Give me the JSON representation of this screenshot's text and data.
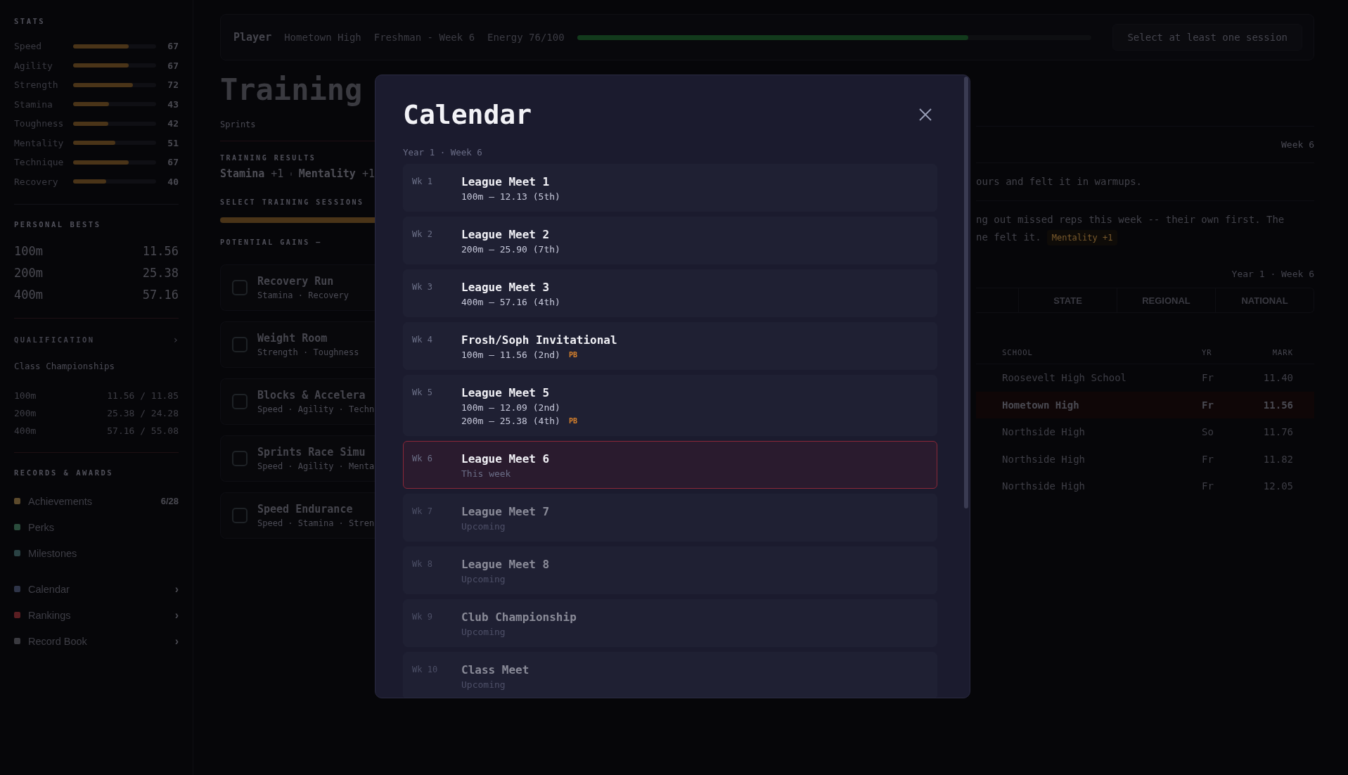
{
  "sidebar": {
    "stats_heading": "STATS",
    "stats": [
      {
        "name": "Speed",
        "level": 0.67,
        "value": "67"
      },
      {
        "name": "Agility",
        "level": 0.67,
        "value": "67"
      },
      {
        "name": "Strength",
        "level": 0.72,
        "value": "72"
      },
      {
        "name": "Stamina",
        "level": 0.43,
        "value": "43"
      },
      {
        "name": "Toughness",
        "level": 0.42,
        "value": "42"
      },
      {
        "name": "Mentality",
        "level": 0.51,
        "value": "51"
      },
      {
        "name": "Technique",
        "level": 0.67,
        "value": "67"
      },
      {
        "name": "Recovery",
        "level": 0.4,
        "value": "40"
      }
    ],
    "bests_heading": "PERSONAL BESTS",
    "bests": [
      {
        "event": "100m",
        "time": "11.56"
      },
      {
        "event": "200m",
        "time": "25.38"
      },
      {
        "event": "400m",
        "time": "57.16"
      }
    ],
    "qualification": {
      "heading": "QUALIFICATION",
      "chevron": "›",
      "meet": "Class Championships",
      "rows": [
        {
          "event": "100m",
          "mark": "11.56 / 11.85"
        },
        {
          "event": "200m",
          "mark": "25.38 / 24.28"
        },
        {
          "event": "400m",
          "mark": "57.16 / 55.08"
        }
      ]
    },
    "records_heading": "RECORDS & AWARDS",
    "records": [
      {
        "label": "Achievements",
        "color": "#5c4a2c",
        "count": "6/28"
      },
      {
        "label": "Perks",
        "color": "#2a4c3c"
      },
      {
        "label": "Milestones",
        "color": "#2a4244"
      }
    ],
    "links": [
      {
        "label": "Calendar",
        "color": "#2e3448",
        "chevron": "›"
      },
      {
        "label": "Rankings",
        "color": "#5a1e22",
        "chevron": "›"
      },
      {
        "label": "Record Book",
        "color": "#3a3a40",
        "chevron": "›"
      }
    ]
  },
  "top_bar": {
    "player": "Player",
    "school": "Hometown High",
    "class_week": "Freshman - Week 6",
    "energy_label": "Energy 76/100",
    "energy": {
      "level": 0.76
    },
    "action_button": {
      "label": "Select at least one session",
      "disabled": true
    }
  },
  "training": {
    "title": "Training",
    "subtitle": "Sprints",
    "results_heading": "TRAINING RESULTS",
    "results": [
      {
        "stat": "Stamina",
        "gain": "+1"
      },
      {
        "stat": "Mentality",
        "gain": "+1"
      }
    ],
    "sessions_heading": "SELECT TRAINING SESSIONS",
    "sessions_bar": {
      "level": 1
    },
    "gains_heading": "POTENTIAL GAINS —",
    "sessions": [
      {
        "name": "Recovery Run",
        "stats": "Stamina · Recovery",
        "checked": false
      },
      {
        "name": "Weight Room",
        "stats": "Strength · Toughness",
        "checked": false
      },
      {
        "name": "Blocks & Accelera",
        "stats": "Speed · Agility · Techn",
        "checked": false
      },
      {
        "name": "Sprints Race Simu",
        "stats": "Speed · Agility · Menta",
        "checked": false
      },
      {
        "name": "Speed Endurance",
        "stats": "Speed · Stamina · Stren",
        "checked": false
      }
    ]
  },
  "news": {
    "week": "Week 6",
    "items": [
      {
        "lines": [
          "ours and felt it in warmups."
        ]
      },
      {
        "lines": [
          "ng out missed reps this week -- their own first. The",
          "ne felt it."
        ],
        "tag": "Mentality +1"
      }
    ]
  },
  "rankings": {
    "period": "Year 1 · Week 6",
    "tabs": [
      "STATE",
      "REGIONAL",
      "NATIONAL"
    ],
    "columns": [
      "SCHOOL",
      "YR",
      "MARK"
    ],
    "rows": [
      {
        "school": "Roosevelt High School",
        "yr": "Fr",
        "mark": "11.40",
        "highlighted": false
      },
      {
        "school": "Hometown High",
        "yr": "Fr",
        "mark": "11.56",
        "highlighted": true
      },
      {
        "school": "Northside High",
        "yr": "So",
        "mark": "11.76",
        "highlighted": false
      },
      {
        "school": "Northside High",
        "yr": "Fr",
        "mark": "11.82",
        "highlighted": false
      },
      {
        "school": "Northside High",
        "yr": "Fr",
        "mark": "12.05",
        "highlighted": false
      }
    ]
  },
  "calendar_modal": {
    "title": "Calendar",
    "subtitle": "Year 1 · Week 6",
    "weeks": [
      {
        "week": "Wk 1",
        "name": "League Meet 1",
        "kind": "past",
        "lines": [
          {
            "text": "100m — 12.13 (5th)"
          }
        ]
      },
      {
        "week": "Wk 2",
        "name": "League Meet 2",
        "kind": "past",
        "lines": [
          {
            "text": "200m — 25.90 (7th)"
          }
        ]
      },
      {
        "week": "Wk 3",
        "name": "League Meet 3",
        "kind": "past",
        "lines": [
          {
            "text": "400m — 57.16 (4th)"
          }
        ]
      },
      {
        "week": "Wk 4",
        "name": "Frosh/Soph Invitational",
        "kind": "past",
        "lines": [
          {
            "text": "100m — 11.56 (2nd)",
            "badge": "PB"
          }
        ]
      },
      {
        "week": "Wk 5",
        "name": "League Meet 5",
        "kind": "past",
        "lines": [
          {
            "text": "100m — 12.09 (2nd)"
          },
          {
            "text": "200m — 25.38 (4th)",
            "badge": "PB"
          }
        ]
      },
      {
        "week": "Wk 6",
        "name": "League Meet 6",
        "kind": "current",
        "lines": [
          {
            "text": "This week"
          }
        ]
      },
      {
        "week": "Wk 7",
        "name": "League Meet 7",
        "kind": "upcoming",
        "lines": [
          {
            "text": "Upcoming"
          }
        ]
      },
      {
        "week": "Wk 8",
        "name": "League Meet 8",
        "kind": "upcoming",
        "lines": [
          {
            "text": "Upcoming"
          }
        ]
      },
      {
        "week": "Wk 9",
        "name": "Club Championship",
        "kind": "upcoming",
        "lines": [
          {
            "text": "Upcoming"
          }
        ]
      },
      {
        "week": "Wk 10",
        "name": "Class Meet",
        "kind": "upcoming",
        "lines": [
          {
            "text": "Upcoming"
          }
        ]
      }
    ]
  }
}
